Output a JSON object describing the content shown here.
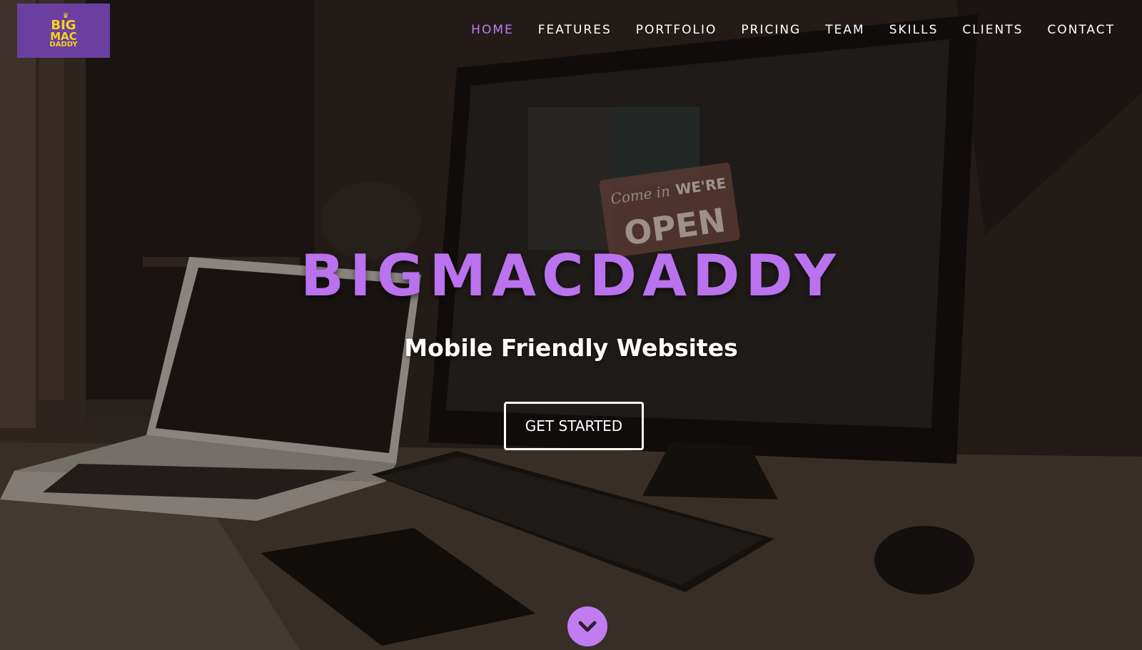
{
  "brand": {
    "logo_lines": [
      "BIG",
      "MAC",
      "DADDY"
    ],
    "logo_bg": "#6b3fa0",
    "logo_text_color": "#f5d516"
  },
  "nav": {
    "items": [
      "HOME",
      "FEATURES",
      "PORTFOLIO",
      "PRICING",
      "TEAM",
      "SKILLS",
      "CLIENTS",
      "CONTACT"
    ],
    "active": "HOME",
    "active_color": "#c27cf2"
  },
  "hero": {
    "title": "BIGMACDADDY",
    "title_color": "#bb72ee",
    "subtitle": "Mobile Friendly Websites",
    "cta_label": "GET STARTED",
    "scroll_icon": "chevron-down-icon",
    "scroll_color": "#c27cf2"
  },
  "background": {
    "sign_text": [
      "Come in",
      "WE'RE",
      "OPEN"
    ]
  }
}
